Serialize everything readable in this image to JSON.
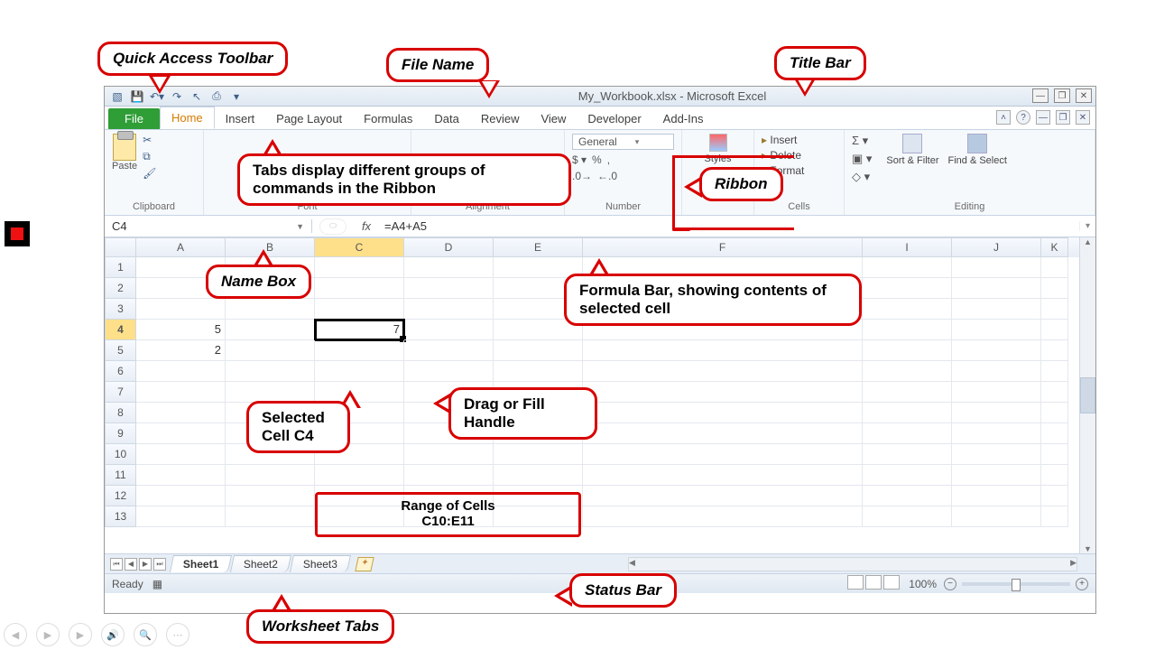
{
  "title": "My_Workbook.xlsx - Microsoft Excel",
  "tabs": {
    "file": "File",
    "home": "Home",
    "insert": "Insert",
    "pagelayout": "Page Layout",
    "formulas": "Formulas",
    "data": "Data",
    "review": "Review",
    "view": "View",
    "developer": "Developer",
    "addins": "Add-Ins"
  },
  "ribbon": {
    "paste": "Paste",
    "groups": {
      "clipboard": "Clipboard",
      "font": "Font",
      "alignment": "Alignment",
      "number": "Number",
      "styles": "Styles",
      "cells": "Cells",
      "editing": "Editing"
    },
    "number_format": "General",
    "cells_items": {
      "insert": "Insert",
      "delete": "Delete",
      "format": "Format"
    },
    "editing": {
      "sort": "Sort & Filter",
      "find": "Find & Select"
    }
  },
  "namebox": "C4",
  "formula": "=A4+A5",
  "columns": [
    "A",
    "B",
    "C",
    "D",
    "E",
    "F",
    "I",
    "J",
    "K"
  ],
  "rows": [
    "1",
    "2",
    "3",
    "4",
    "5",
    "6",
    "7",
    "8",
    "9",
    "10",
    "11",
    "12",
    "13"
  ],
  "cells": {
    "A4": "5",
    "A5": "2",
    "C4": "7"
  },
  "sheets": {
    "s1": "Sheet1",
    "s2": "Sheet2",
    "s3": "Sheet3"
  },
  "status": "Ready",
  "zoom": "100%",
  "callouts": {
    "qat": "Quick Access Toolbar",
    "filename": "File Name",
    "titlebar": "Title Bar",
    "tabs": "Tabs display different groups of commands in the Ribbon",
    "ribbon": "Ribbon",
    "namebox": "Name Box",
    "formulabar": "Formula Bar, showing contents of selected cell",
    "selected": "Selected Cell C4",
    "fill": "Drag or Fill Handle",
    "range1": "Range of Cells",
    "range2": "C10:E11",
    "wstabs": "Worksheet Tabs",
    "statusbar": "Status Bar"
  }
}
